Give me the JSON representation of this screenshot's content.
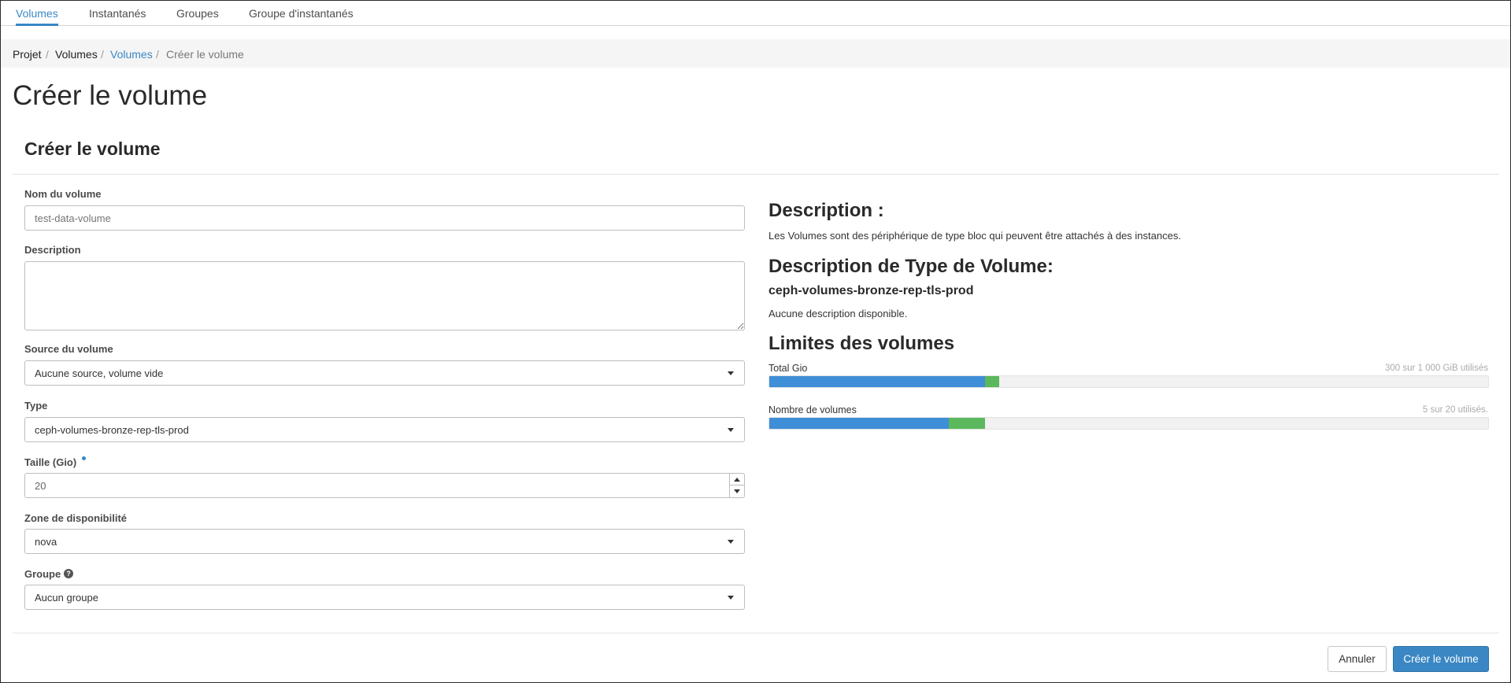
{
  "tabs": [
    {
      "label": "Volumes",
      "active": true
    },
    {
      "label": "Instantanés",
      "active": false
    },
    {
      "label": "Groupes",
      "active": false
    },
    {
      "label": "Groupe d'instantanés",
      "active": false
    }
  ],
  "breadcrumb": [
    "Projet",
    "Volumes",
    "Volumes",
    "Créer le volume"
  ],
  "page_title": "Créer le volume",
  "modal_title": "Créer le volume",
  "form": {
    "name_label": "Nom du volume",
    "name_placeholder": "test-data-volume",
    "description_label": "Description",
    "description_value": "",
    "source_label": "Source du volume",
    "source_value": "Aucune source, volume vide",
    "type_label": "Type",
    "type_value": "ceph-volumes-bronze-rep-tls-prod",
    "size_label": "Taille (Gio)",
    "size_value": "20",
    "az_label": "Zone de disponibilité",
    "az_value": "nova",
    "group_label": "Groupe",
    "group_value": "Aucun groupe"
  },
  "info": {
    "desc_heading": "Description :",
    "desc_text": "Les Volumes sont des périphérique de type bloc qui peuvent être attachés à des instances.",
    "type_heading": "Description de Type de Volume:",
    "type_name": "ceph-volumes-bronze-rep-tls-prod",
    "type_desc": "Aucune description disponible.",
    "limits_heading": "Limites des volumes",
    "quotas": [
      {
        "label": "Total Gio",
        "usage_text": "300 sur 1 000 GiB utilisés",
        "used": 300,
        "adding": 20,
        "limit": 1000
      },
      {
        "label": "Nombre de volumes",
        "usage_text": "5 sur 20 utilisés.",
        "used": 5,
        "adding": 1,
        "limit": 20
      }
    ]
  },
  "buttons": {
    "cancel": "Annuler",
    "submit": "Créer le volume"
  },
  "colors": {
    "accent": "#3a87c4",
    "quota_used": "#3f8ed8",
    "quota_new": "#5cb85c"
  },
  "icons": {
    "select_caret": "chevron-down-icon",
    "help": "question-circle-icon"
  }
}
